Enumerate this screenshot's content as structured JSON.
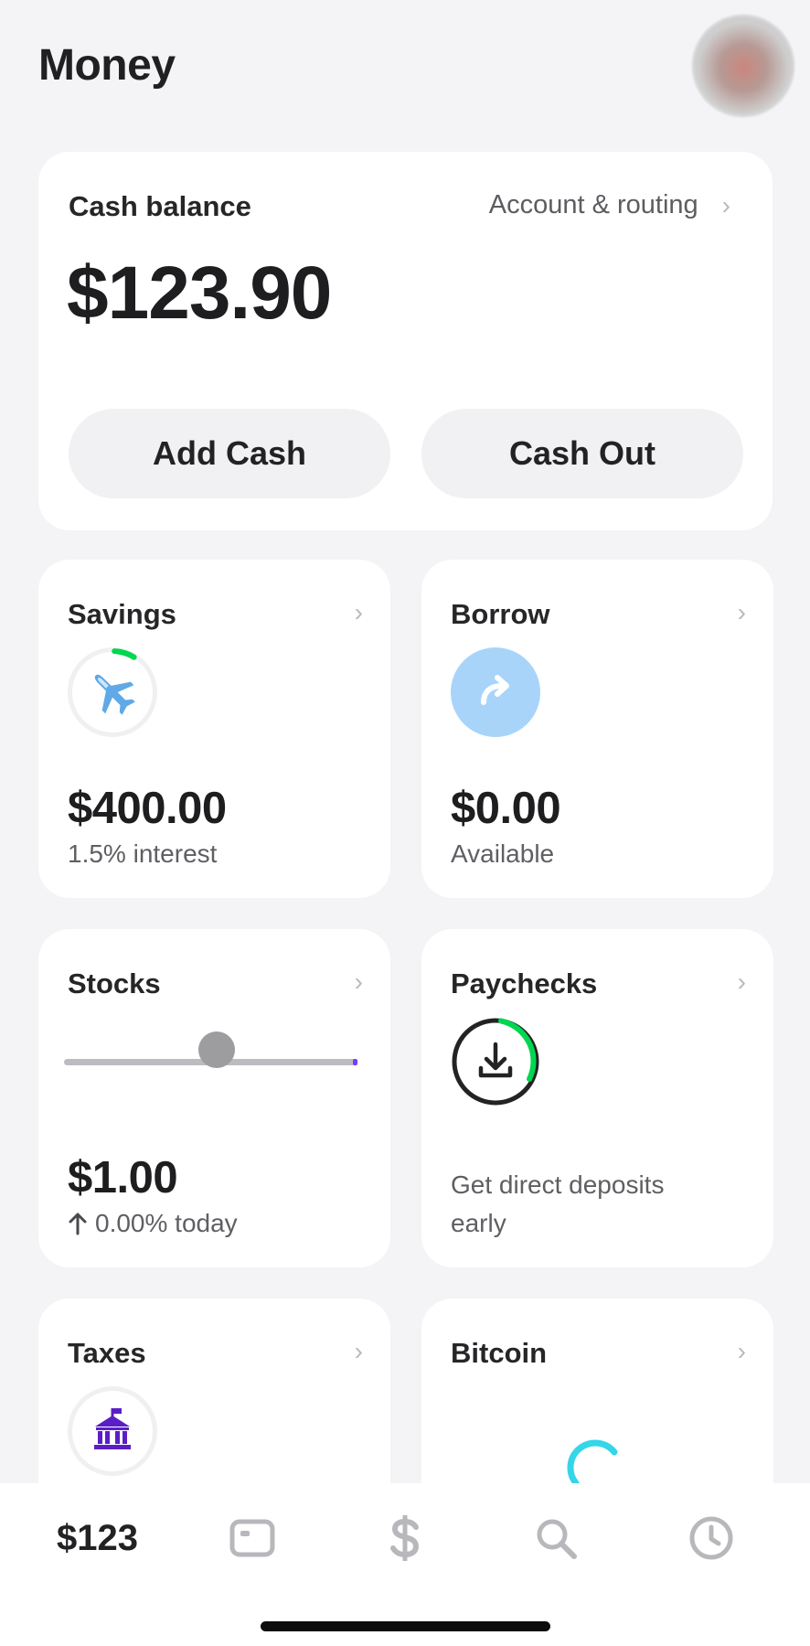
{
  "header": {
    "title": "Money"
  },
  "balance_card": {
    "label": "Cash balance",
    "account_link": "Account & routing",
    "amount": "$123.90",
    "add_cash": "Add Cash",
    "cash_out": "Cash Out"
  },
  "tiles": {
    "savings": {
      "title": "Savings",
      "amount": "$400.00",
      "sub": "1.5% interest",
      "icon": "airplane-icon",
      "goal_progress_fraction": 0.08
    },
    "borrow": {
      "title": "Borrow",
      "amount": "$0.00",
      "sub": "Available",
      "icon": "curved-arrow-icon"
    },
    "stocks": {
      "title": "Stocks",
      "amount": "$1.00",
      "sub": "0.00% today",
      "trend": "up-arrow-icon"
    },
    "paychecks": {
      "title": "Paychecks",
      "sub": "Get direct deposits early",
      "icon": "download-icon"
    },
    "taxes": {
      "title": "Taxes",
      "icon": "bank-building-icon"
    },
    "bitcoin": {
      "title": "Bitcoin",
      "icon": "loading-spinner-icon"
    }
  },
  "bottom_nav": {
    "balance": "$123",
    "items": [
      "card-icon",
      "dollar-icon",
      "search-icon",
      "clock-icon"
    ]
  },
  "colors": {
    "background": "#f4f4f6",
    "card": "#ffffff",
    "green_progress": "#00d64f",
    "borrow_blue": "#a9d4fa",
    "taxes_purple": "#5a1ec8",
    "bitcoin_spinner": "#34d6e8"
  }
}
